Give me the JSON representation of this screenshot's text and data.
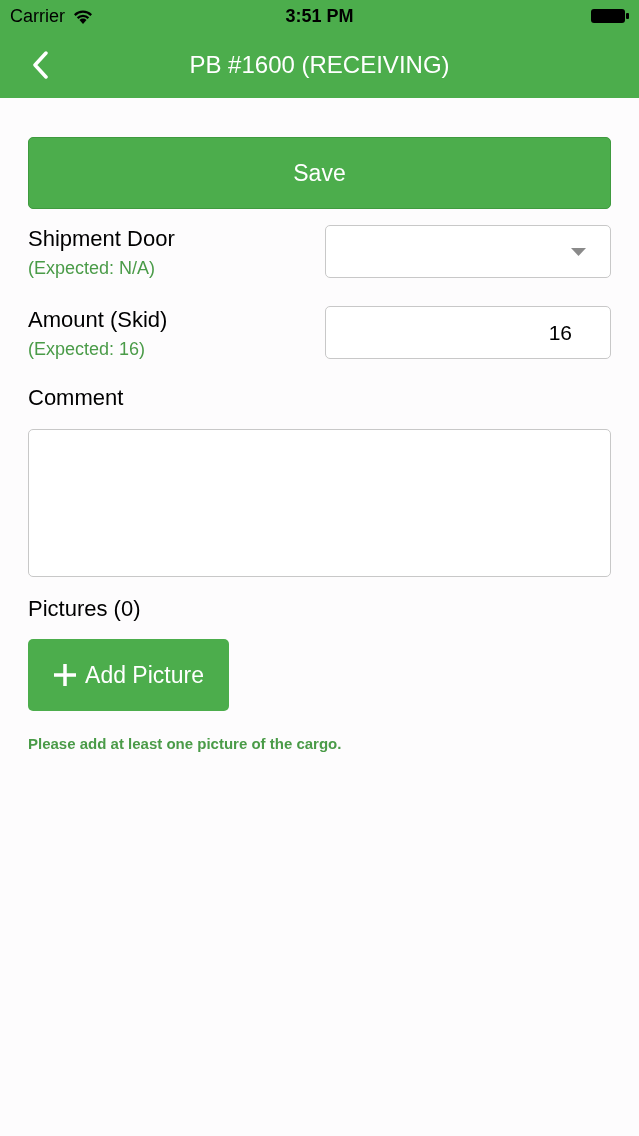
{
  "status_bar": {
    "carrier": "Carrier",
    "time": "3:51 PM"
  },
  "nav_bar": {
    "title": "PB #1600 (RECEIVING)"
  },
  "save_button": {
    "label": "Save"
  },
  "fields": [
    {
      "kind": "select",
      "label": "Shipment Door",
      "expected": "(Expected: N/A)"
    },
    {
      "kind": "number",
      "label": "Amount (Skid)",
      "expected": "(Expected: 16)",
      "value": "16"
    }
  ],
  "comment": {
    "label": "Comment"
  },
  "pictures": {
    "label": "Pictures (0)",
    "button": "Add Picture",
    "hint": "Please add at least one picture of the cargo."
  }
}
